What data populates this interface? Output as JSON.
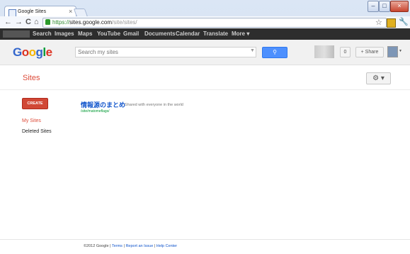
{
  "browser": {
    "tab_title": "Google Sites",
    "tab_close": "×",
    "window_buttons": [
      "–",
      "□",
      "×"
    ],
    "url": {
      "scheme": "https://",
      "host": "sites.google.com",
      "path": "/site/sites/"
    },
    "nav_glyphs": {
      "back": "←",
      "forward": "→",
      "reload": "C",
      "home": "⌂"
    },
    "star_glyph": "☆",
    "wrench_glyph": "🔧"
  },
  "gbar": {
    "items": [
      "Search",
      "Images",
      "Maps",
      "YouTube",
      "Gmail",
      "Documents",
      "Calendar",
      "Translate",
      "More ▾"
    ]
  },
  "header": {
    "logo_letters": [
      {
        "ch": "G",
        "color": "#3366cc"
      },
      {
        "ch": "o",
        "color": "#dd3322"
      },
      {
        "ch": "o",
        "color": "#f5b400"
      },
      {
        "ch": "g",
        "color": "#3366cc"
      },
      {
        "ch": "l",
        "color": "#009933"
      },
      {
        "ch": "e",
        "color": "#dd3322"
      }
    ],
    "search_placeholder": "Search my sites",
    "search_button_icon": "⚲",
    "notification_count": "0",
    "share_label": "+ Share"
  },
  "main": {
    "page_title": "Sites",
    "settings_glyph": "⚙ ▾",
    "create_label": "CREATE",
    "nav": {
      "my_sites": "My Sites",
      "deleted_sites": "Deleted Sites"
    },
    "sites": [
      {
        "name": "情報源のまとめ",
        "sharing": "Shared with everyone in the world",
        "path": "/site/matomeflags/"
      }
    ]
  },
  "footer": {
    "copyright": "©2012 Google",
    "links": [
      "Terms",
      "Report an Issue",
      "Help Center"
    ],
    "separator": " | "
  },
  "colors": {
    "accent_red": "#dd4b39",
    "link_blue": "#1155cc",
    "search_blue": "#4d90fe",
    "path_green": "#009933"
  }
}
